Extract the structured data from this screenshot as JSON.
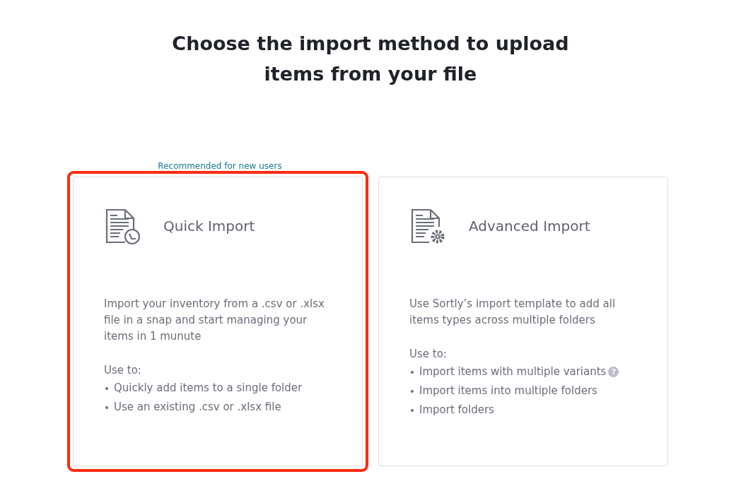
{
  "heading": "Choose the import method to upload items from your file",
  "cards": [
    {
      "kind": "quick",
      "badge": "Recommended for new users",
      "selected": true,
      "title": "Quick Import",
      "description": "Import your inventory from a .csv or .xlsx file in a snap and start managing your items in 1 munute",
      "use_label": "Use to:",
      "uses": [
        {
          "text": "Quickly add items to a single folder"
        },
        {
          "text": "Use an existing .csv or .xlsx file"
        }
      ]
    },
    {
      "kind": "advanced",
      "selected": false,
      "title": "Advanced Import",
      "description": "Use Sortly’s import template to add all items types across multiple folders",
      "use_label": "Use to:",
      "uses": [
        {
          "text": "Import items with multiple variants",
          "help": "?"
        },
        {
          "text": "Import items into multiple folders"
        },
        {
          "text": "Import folders"
        }
      ]
    }
  ]
}
